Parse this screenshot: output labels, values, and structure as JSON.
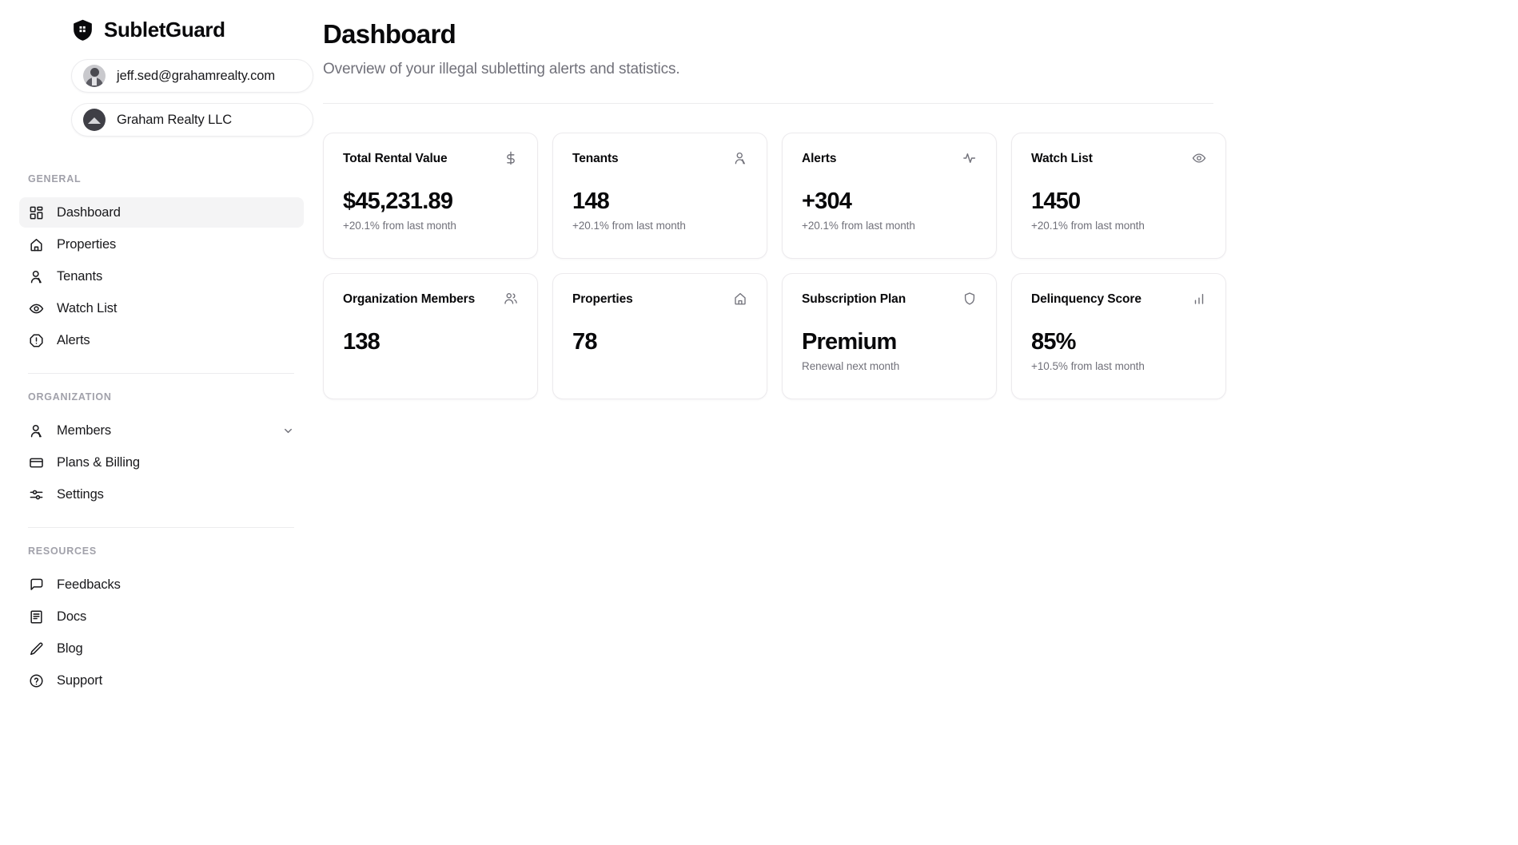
{
  "brand": {
    "name": "SubletGuard",
    "logo_icon": "shield-house-icon"
  },
  "account": {
    "user_email": "jeff.sed@grahamrealty.com",
    "user_avatar_icon": "user-avatar",
    "organization": "Graham Realty LLC",
    "organization_avatar_icon": "organization-avatar"
  },
  "sidebar": {
    "sections": [
      {
        "label": "GENERAL",
        "items": [
          {
            "label": "Dashboard",
            "icon": "layout-grid-icon",
            "active": true
          },
          {
            "label": "Properties",
            "icon": "home-icon",
            "active": false
          },
          {
            "label": "Tenants",
            "icon": "user-icon",
            "active": false
          },
          {
            "label": "Watch List",
            "icon": "eye-icon",
            "active": false
          },
          {
            "label": "Alerts",
            "icon": "alert-octagon-icon",
            "active": false
          }
        ]
      },
      {
        "label": "ORGANIZATION",
        "items": [
          {
            "label": "Members",
            "icon": "user-icon",
            "active": false,
            "chevron": "chevron-down-icon"
          },
          {
            "label": "Plans & Billing",
            "icon": "credit-card-icon",
            "active": false
          },
          {
            "label": "Settings",
            "icon": "sliders-icon",
            "active": false
          }
        ]
      },
      {
        "label": "RESOURCES",
        "items": [
          {
            "label": "Feedbacks",
            "icon": "message-square-icon",
            "active": false
          },
          {
            "label": "Docs",
            "icon": "book-icon",
            "active": false
          },
          {
            "label": "Blog",
            "icon": "pencil-icon",
            "active": false
          },
          {
            "label": "Support",
            "icon": "help-circle-icon",
            "active": false
          }
        ]
      }
    ]
  },
  "page": {
    "title": "Dashboard",
    "subtitle": "Overview of your illegal subletting alerts and statistics."
  },
  "cards": [
    {
      "title": "Total Rental Value",
      "icon": "dollar-sign-icon",
      "value": "$45,231.89",
      "footnote": "+20.1% from last month"
    },
    {
      "title": "Tenants",
      "icon": "user-icon",
      "value": "148",
      "footnote": "+20.1% from last month"
    },
    {
      "title": "Alerts",
      "icon": "activity-icon",
      "value": "+304",
      "footnote": "+20.1% from last month"
    },
    {
      "title": "Watch List",
      "icon": "eye-icon",
      "value": "1450",
      "footnote": "+20.1% from last month"
    },
    {
      "title": "Organization Members",
      "icon": "users-icon",
      "value": "138",
      "footnote": ""
    },
    {
      "title": "Properties",
      "icon": "home-icon",
      "value": "78",
      "footnote": ""
    },
    {
      "title": "Subscription Plan",
      "icon": "shield-icon",
      "value": "Premium",
      "footnote": "Renewal next month"
    },
    {
      "title": "Delinquency Score",
      "icon": "bar-chart-icon",
      "value": "85%",
      "footnote": "+10.5% from last month"
    }
  ],
  "colors": {
    "background": "#ffffff",
    "text": "#09090b",
    "muted": "#71717a",
    "border": "#ececee",
    "active_item_bg": "#f4f4f5"
  }
}
